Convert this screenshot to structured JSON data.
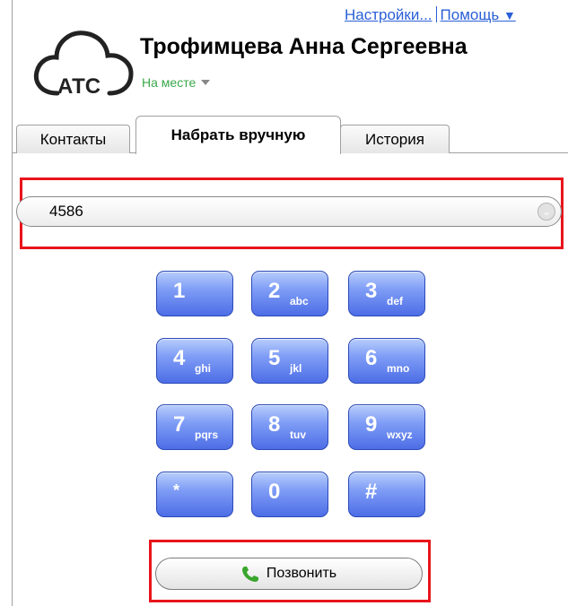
{
  "header": {
    "settings_link": "Настройки...",
    "help_link": "Помощь",
    "help_caret": "▼",
    "logo_text": "АТС",
    "user_name": "Трофимцева Анна Сергеевна",
    "status": "На месте"
  },
  "tabs": [
    {
      "label": "Контакты"
    },
    {
      "label": "Набрать вручную"
    },
    {
      "label": "История"
    }
  ],
  "active_tab": "Набрать вручную",
  "dial": {
    "value": "4586",
    "dropdown_glyph": "⌄"
  },
  "keypad": [
    {
      "digit": "1",
      "letters": ""
    },
    {
      "digit": "2",
      "letters": "abc"
    },
    {
      "digit": "3",
      "letters": "def"
    },
    {
      "digit": "4",
      "letters": "ghi"
    },
    {
      "digit": "5",
      "letters": "jkl"
    },
    {
      "digit": "6",
      "letters": "mno"
    },
    {
      "digit": "7",
      "letters": "pqrs"
    },
    {
      "digit": "8",
      "letters": "tuv"
    },
    {
      "digit": "9",
      "letters": "wxyz"
    },
    {
      "digit": "*",
      "letters": ""
    },
    {
      "digit": "0",
      "letters": ""
    },
    {
      "digit": "#",
      "letters": ""
    }
  ],
  "call_button": {
    "label": "Позвонить",
    "icon": "phone-icon"
  },
  "colors": {
    "link": "#2a5fd6",
    "status_green": "#3aa84a",
    "highlight_red": "#e8141b",
    "key_blue": "#4d6de6"
  }
}
